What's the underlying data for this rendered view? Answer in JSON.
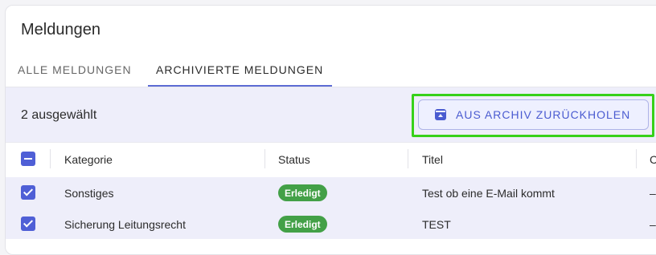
{
  "page_title": "Meldungen",
  "tabs": [
    {
      "label": "ALLE MELDUNGEN",
      "active": false
    },
    {
      "label": "ARCHIVIERTE MELDUNGEN",
      "active": true
    }
  ],
  "selection": {
    "count_text": "2 ausgewählt",
    "restore_button_label": "AUS ARCHIV ZURÜCKHOLEN",
    "restore_icon": "unarchive-icon"
  },
  "table": {
    "columns": [
      "Kategorie",
      "Status",
      "Titel",
      "C"
    ],
    "rows": [
      {
        "checked": true,
        "kategorie": "Sonstiges",
        "status": "Erledigt",
        "titel": "Test ob eine E-Mail kommt",
        "extra": "–"
      },
      {
        "checked": true,
        "kategorie": "Sicherung Leitungsrecht",
        "status": "Erledigt",
        "titel": "TEST",
        "extra": "–"
      }
    ]
  },
  "colors": {
    "accent": "#4f5fd6",
    "status_done": "#43a047",
    "selection_bg": "#eeeefa",
    "highlight": "#37d11a"
  }
}
